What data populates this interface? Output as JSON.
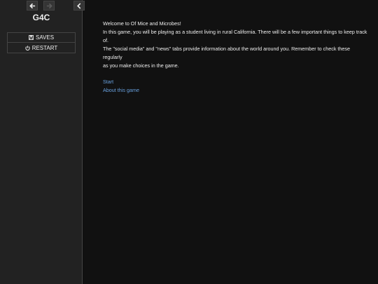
{
  "sidebar": {
    "nav": {
      "back_icon": "arrow-left-icon",
      "forward_icon": "arrow-right-icon",
      "toggle_icon": "chevron-left-icon"
    },
    "title": "G4C",
    "menu": {
      "saves_label": "SAVES",
      "saves_icon": "floppy-disk-icon",
      "restart_label": "RESTART",
      "restart_icon": "power-icon"
    }
  },
  "passage": {
    "lines": [
      "Welcome to Of Mice and Microbes!",
      "In this game, you will be playing as a student living in rural California. There will be a few important things to keep track of.",
      "The \"social media\" and \"news\" tabs provide information about the world around you. Remember to check these regularly",
      "as you make choices in the game."
    ],
    "links": {
      "start": "Start",
      "about": "About this game"
    }
  },
  "colors": {
    "background": "#111111",
    "sidebar": "#222222",
    "text": "#eeeeee",
    "link": "#68a0dd"
  }
}
